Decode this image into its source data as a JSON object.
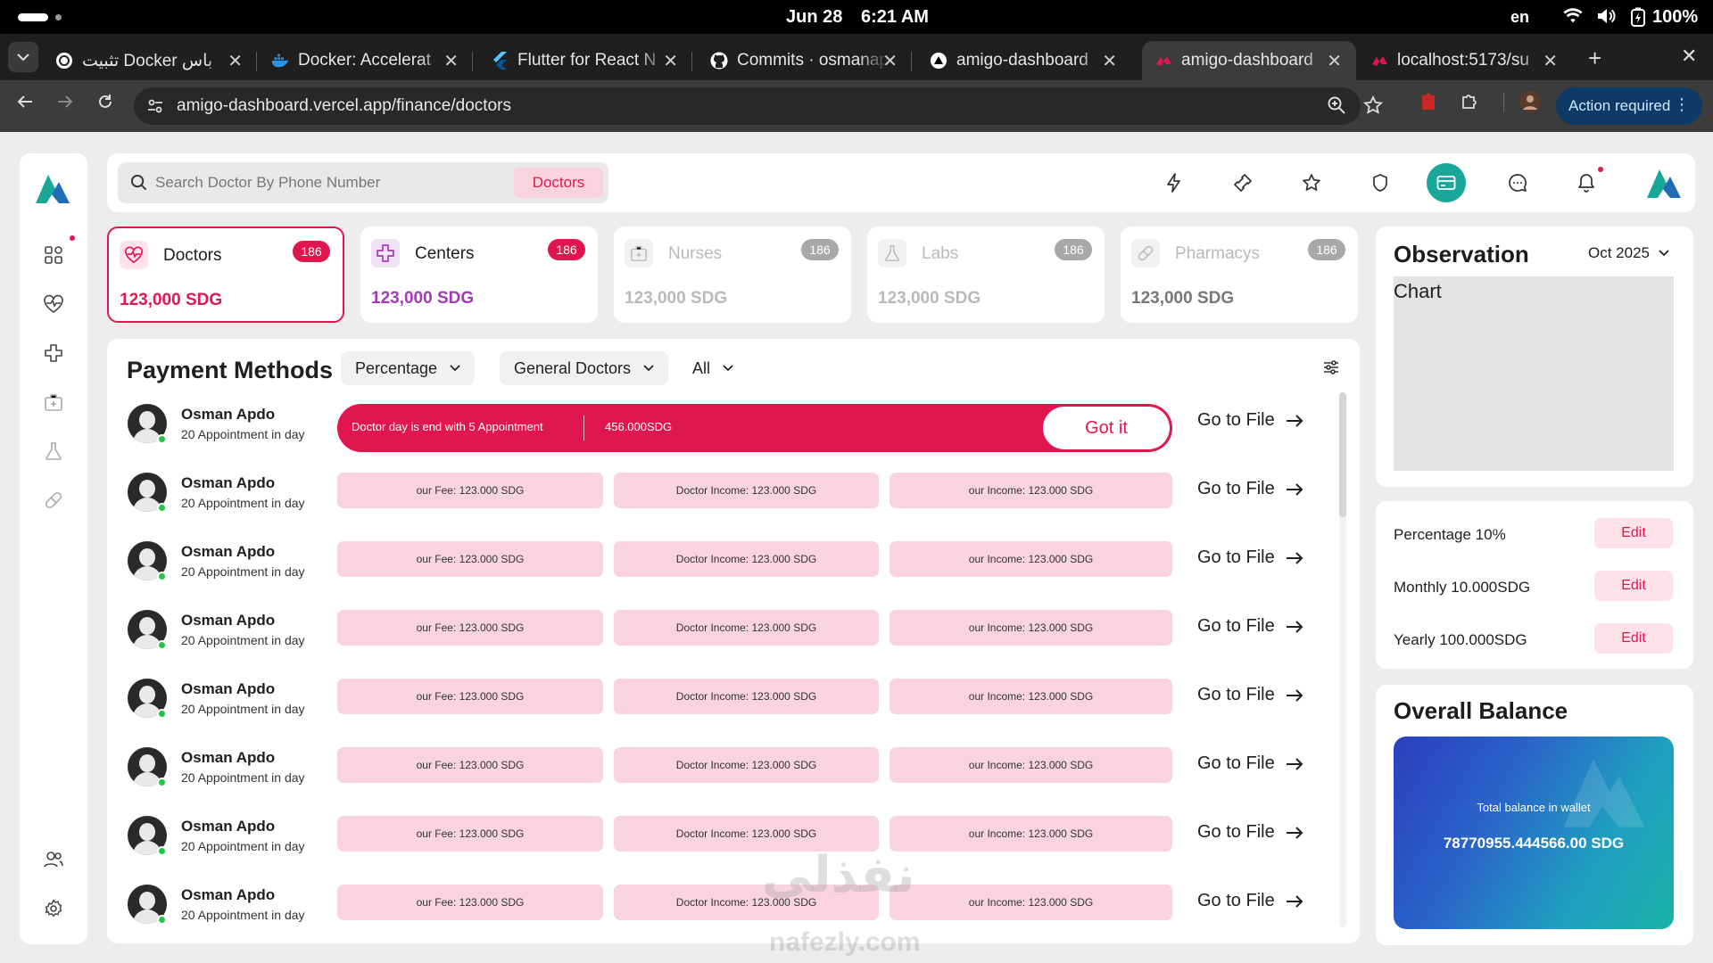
{
  "os": {
    "date": "Jun 28",
    "time": "6:21 AM",
    "lang": "en",
    "battery": "100%"
  },
  "browser": {
    "tabs": [
      {
        "title": "تثبيت Docker باس",
        "icon": "openai-icon"
      },
      {
        "title": "Docker: Accelerat",
        "icon": "docker-icon"
      },
      {
        "title": "Flutter for React N",
        "icon": "flutter-icon"
      },
      {
        "title": "Commits · osmanap",
        "icon": "github-icon"
      },
      {
        "title": "amigo-dashboard",
        "icon": "vercel-icon"
      },
      {
        "title": "amigo-dashboard",
        "icon": "app-icon",
        "active": true
      },
      {
        "title": "localhost:5173/su",
        "icon": "app-icon"
      }
    ],
    "url": "amigo-dashboard.vercel.app/finance/doctors",
    "action_required": "Action required"
  },
  "topbar": {
    "search_placeholder": "Search Doctor By Phone Number",
    "search_chip": "Doctors"
  },
  "categories": [
    {
      "name": "Doctors",
      "count": "186",
      "amount": "123,000 SDG",
      "active": true,
      "amount_color": "#e0174f"
    },
    {
      "name": "Centers",
      "count": "186",
      "amount": "123,000 SDG",
      "active": false,
      "amount_color": "#a23ab8"
    },
    {
      "name": "Nurses",
      "count": "186",
      "amount": "123,000 SDG",
      "dim": true
    },
    {
      "name": "Labs",
      "count": "186",
      "amount": "123,000 SDG",
      "dim": true
    },
    {
      "name": "Pharmacys",
      "count": "186",
      "amount": "123,000 SDG",
      "dim": true
    }
  ],
  "payment": {
    "title": "Payment Methods",
    "filters": {
      "type": "Percentage",
      "group": "General Doctors",
      "scope": "All"
    },
    "alert": {
      "text": "Doctor day is end with 5 Appointment",
      "amount": "456.000SDG",
      "button": "Got it"
    },
    "go_to_file": "Go to File",
    "rows": [
      {
        "name": "Osman Apdo",
        "sub": "20 Appointment in day"
      },
      {
        "name": "Osman Apdo",
        "sub": "20 Appointment in day",
        "fee": "our Fee: 123.000 SDG",
        "doctor_income": "Doctor Income: 123.000 SDG",
        "our_income": "our Income: 123.000 SDG"
      },
      {
        "name": "Osman Apdo",
        "sub": "20 Appointment in day",
        "fee": "our Fee: 123.000 SDG",
        "doctor_income": "Doctor Income: 123.000 SDG",
        "our_income": "our Income: 123.000 SDG"
      },
      {
        "name": "Osman Apdo",
        "sub": "20 Appointment in day",
        "fee": "our Fee: 123.000 SDG",
        "doctor_income": "Doctor Income: 123.000 SDG",
        "our_income": "our Income: 123.000 SDG"
      },
      {
        "name": "Osman Apdo",
        "sub": "20 Appointment in day",
        "fee": "our Fee: 123.000 SDG",
        "doctor_income": "Doctor Income: 123.000 SDG",
        "our_income": "our Income: 123.000 SDG"
      },
      {
        "name": "Osman Apdo",
        "sub": "20 Appointment in day",
        "fee": "our Fee: 123.000 SDG",
        "doctor_income": "Doctor Income: 123.000 SDG",
        "our_income": "our Income: 123.000 SDG"
      },
      {
        "name": "Osman Apdo",
        "sub": "20 Appointment in day",
        "fee": "our Fee: 123.000 SDG",
        "doctor_income": "Doctor Income: 123.000 SDG",
        "our_income": "our Income: 123.000 SDG"
      },
      {
        "name": "Osman Apdo",
        "sub": "20 Appointment in day",
        "fee": "our Fee: 123.000 SDG",
        "doctor_income": "Doctor Income: 123.000 SDG",
        "our_income": "our Income: 123.000 SDG"
      }
    ]
  },
  "observation": {
    "title": "Observation",
    "period": "Oct 2025",
    "chart_label": "Chart"
  },
  "settings": {
    "edit_label": "Edit",
    "items": [
      "Percentage 10%",
      "Monthly 10.000SDG",
      "Yearly 100.000SDG"
    ]
  },
  "balance": {
    "title": "Overall Balance",
    "label": "Total balance in wallet",
    "amount": "78770955.444566.00 SDG"
  },
  "watermark": {
    "text": "نفذلي",
    "domain": "nafezly.com"
  },
  "colors": {
    "accent": "#e0174f",
    "teal": "#19a79a",
    "pink_soft": "#f9d4df"
  }
}
